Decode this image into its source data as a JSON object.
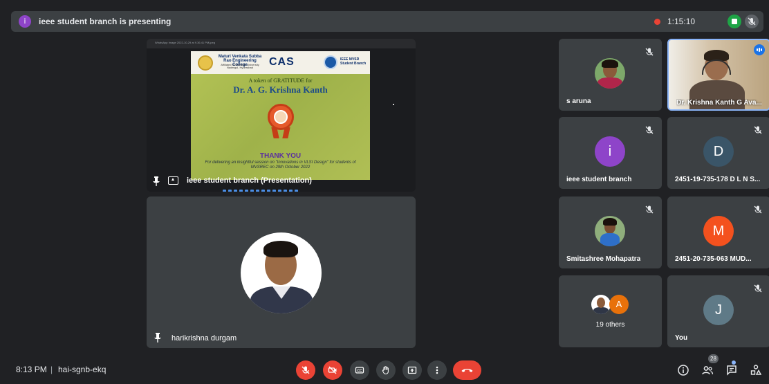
{
  "topbar": {
    "presenter_initial": "i",
    "presenting_text": "ieee student branch is presenting",
    "timer": "1:15:10"
  },
  "presentation": {
    "window_title": "WhatsApp Image 2022-10-29 at 9.36.41 PM.jpeg",
    "title": "ieee student branch (Presentation)",
    "slide": {
      "college_name": "Maturi Venkata Subba Rao Engineering College",
      "college_sub": "Affiliated to Osmania University Nadergul, Hyderabad",
      "cas_logo": "CAS",
      "ieee_name": "IEEE MVSR Student Branch",
      "token_text": "A token of GRATITUDE for",
      "honoree": "Dr. A. G. Krishna Kanth",
      "thanks": "THANK YOU",
      "delivering": "For delivering an insightful session on \"Innovations in VLSI Design\" for students of MVSREC on 29th October 2022"
    }
  },
  "main_speaker": {
    "name": "harikrishna durgam"
  },
  "participants": [
    {
      "name": "s aruna",
      "type": "photo",
      "muted": true
    },
    {
      "name": "Dr. Krishna Kanth G Ava...",
      "type": "video",
      "speaking": true
    },
    {
      "name": "ieee student branch",
      "initial": "i",
      "color": "#8e44c9",
      "muted": true
    },
    {
      "name": "2451-19-735-178 D L N S...",
      "initial": "D",
      "color": "#3a5568",
      "muted": true
    },
    {
      "name": "Smitashree Mohapatra",
      "type": "photo",
      "muted": true
    },
    {
      "name": "2451-20-735-063 MUD...",
      "initial": "M",
      "color": "#f4511e",
      "muted": true
    },
    {
      "others_label": "19 others",
      "others_initial": "A",
      "others_color": "#e8710a"
    },
    {
      "name": "You",
      "initial": "J",
      "color": "#5f7a87",
      "muted": true
    }
  ],
  "bottombar": {
    "time": "8:13 PM",
    "separator": "|",
    "meeting_code": "hai-sgnb-ekq",
    "people_count": "28"
  },
  "colors": {
    "background": "#202124",
    "tile": "#3c4043",
    "danger": "#ea4335",
    "record_green": "#1ea446",
    "accent_blue": "#8ab4f8"
  }
}
